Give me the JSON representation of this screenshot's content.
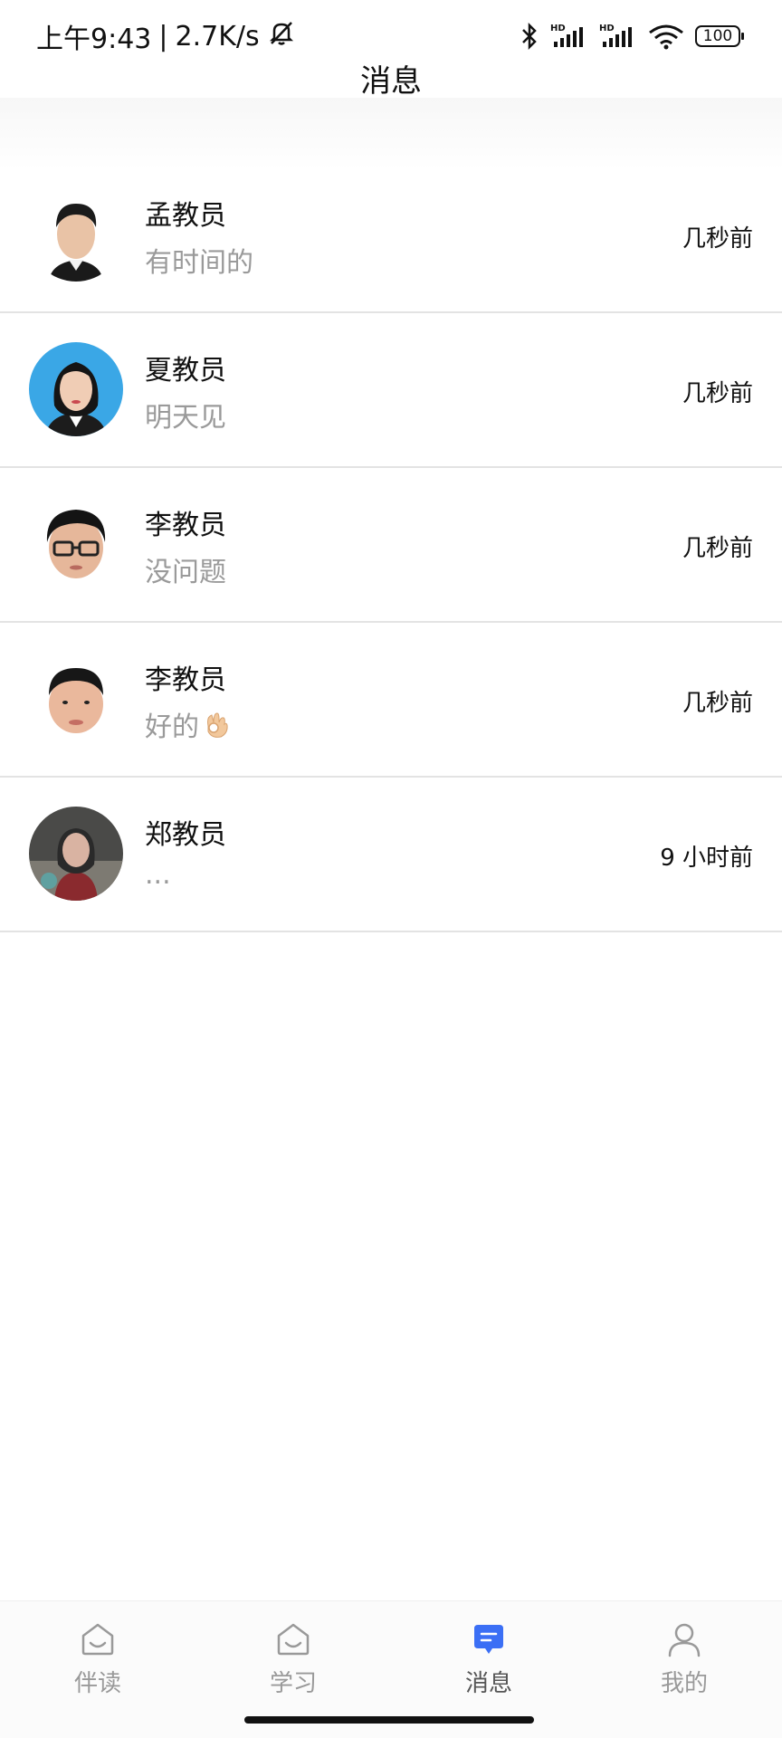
{
  "status_bar": {
    "time": "上午9:43",
    "speed": "2.7K/s",
    "battery": "100",
    "icons": [
      "mute-bell-icon",
      "bluetooth-icon",
      "hd-signal-icon",
      "hd-signal-icon",
      "wifi-icon",
      "battery-icon"
    ]
  },
  "header": {
    "title": "消息"
  },
  "conversations": [
    {
      "name": "孟教员",
      "message": "有时间的",
      "time": "几秒前"
    },
    {
      "name": "夏教员",
      "message": "明天见",
      "time": "几秒前"
    },
    {
      "name": "李教员",
      "message": "没问题",
      "time": "几秒前"
    },
    {
      "name": "李教员",
      "message": "好的",
      "time": "几秒前",
      "emoji": "ok-hand-icon"
    },
    {
      "name": "郑教员",
      "message": "...",
      "time": "9 小时前"
    }
  ],
  "bottom_nav": {
    "items": [
      {
        "label": "伴读",
        "icon": "companion-read-icon"
      },
      {
        "label": "学习",
        "icon": "study-icon"
      },
      {
        "label": "消息",
        "icon": "message-icon",
        "active": true
      },
      {
        "label": "我的",
        "icon": "profile-icon"
      }
    ],
    "active_color": "#3b6ff5",
    "inactive_color": "#999999"
  }
}
